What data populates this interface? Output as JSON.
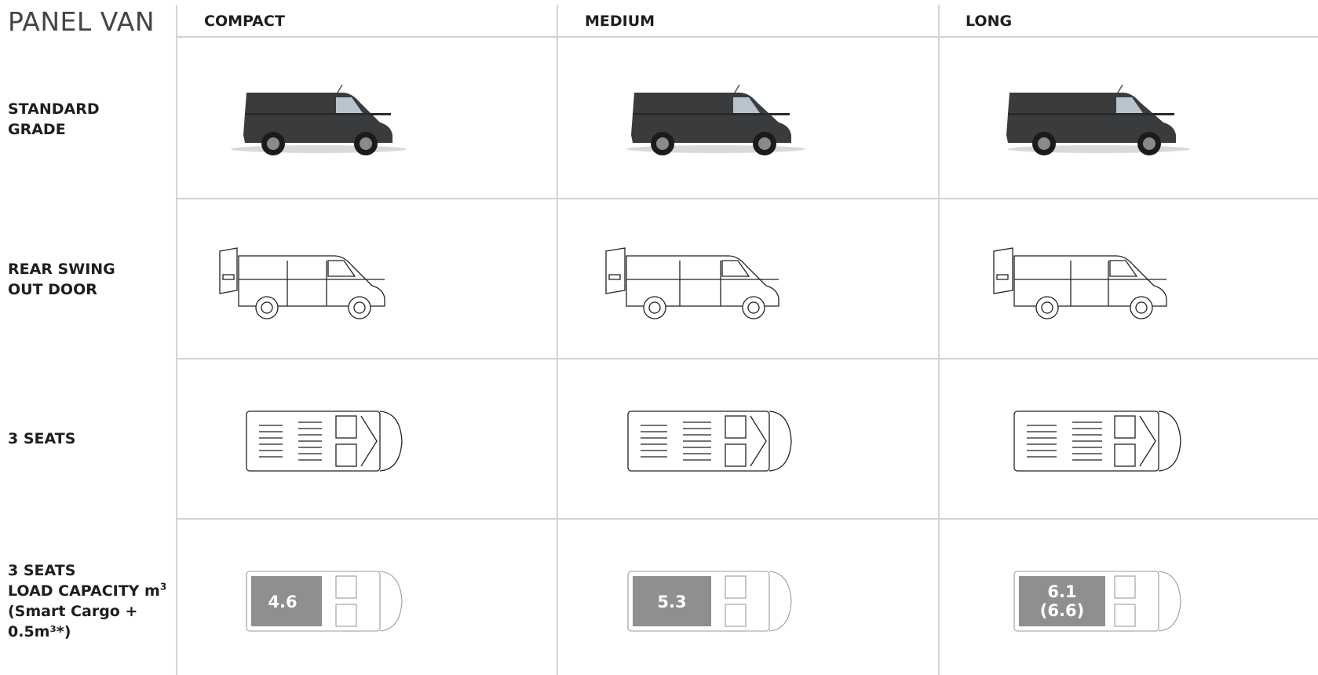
{
  "table": {
    "title": "PANEL VAN",
    "columns": [
      "COMPACT",
      "MEDIUM",
      "LONG"
    ],
    "rows": [
      {
        "label_lines": [
          "STANDARD",
          "GRADE"
        ],
        "image": "van-side-photo-dark-grey"
      },
      {
        "label_lines": [
          "REAR SWING",
          "OUT DOOR"
        ],
        "image": "van-side-line-drawing-rear-door-open"
      },
      {
        "label_lines": [
          "3 SEATS"
        ],
        "image": "van-top-view-line-drawing"
      },
      {
        "label_lines": [
          "3 SEATS",
          "LOAD CAPACITY m",
          "(Smart Cargo +",
          "0.5m³*)"
        ],
        "label_sup": "3",
        "image": "van-top-view-load-area"
      }
    ],
    "load_capacity": [
      {
        "column": "COMPACT",
        "value": "4.6",
        "value2": ""
      },
      {
        "column": "MEDIUM",
        "value": "5.3",
        "value2": ""
      },
      {
        "column": "LONG",
        "value": "6.1",
        "value2": "(6.6)"
      }
    ]
  },
  "colors": {
    "divider": "#d3d6d6",
    "van_body": "#3a3b3d",
    "load_area": "#8f8f8f",
    "text": "#1e1e1e"
  }
}
